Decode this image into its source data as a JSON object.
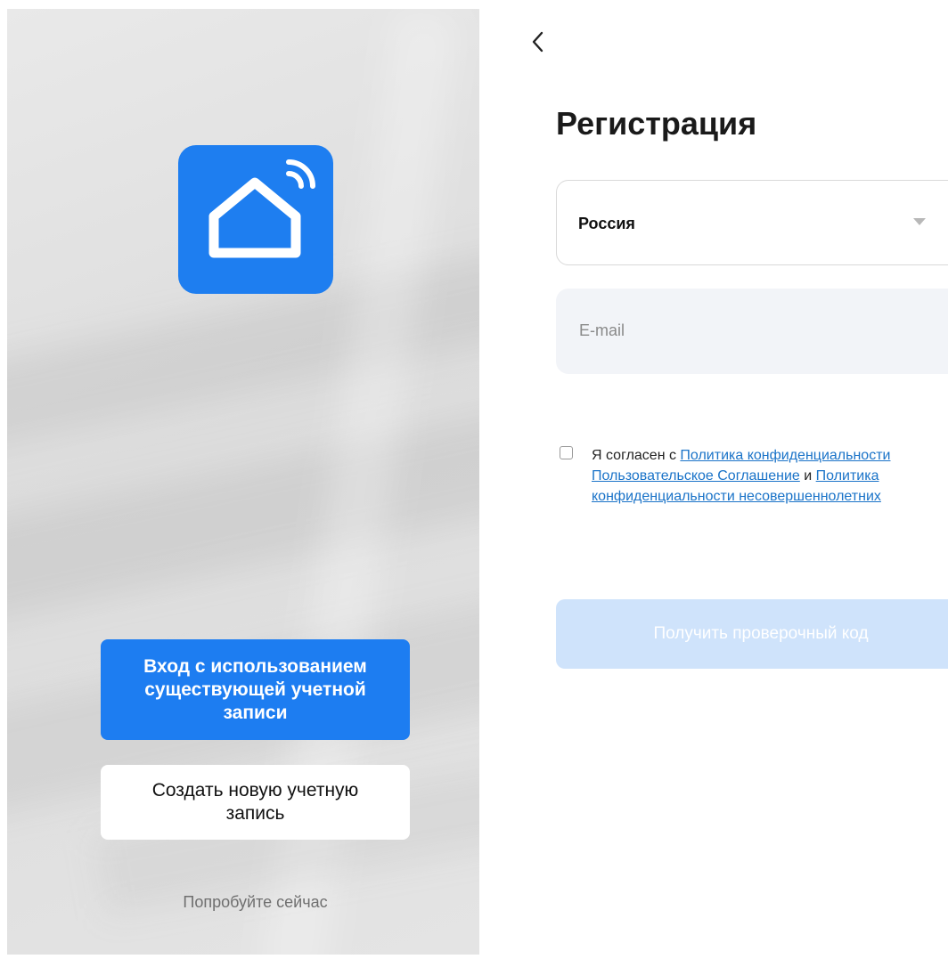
{
  "left_screen": {
    "login_button_label": "Вход с использованием существующей учетной записи",
    "create_account_label": "Создать новую учетную запись",
    "try_now_label": "Попробуйте сейчас",
    "brand_color": "#1e7ef0",
    "app_icon": "smart-home-wifi-icon"
  },
  "right_screen": {
    "back_icon": "chevron-left-icon",
    "title": "Регистрация",
    "country": {
      "value": "Россия",
      "caret_icon": "caret-down-icon"
    },
    "email": {
      "placeholder": "E-mail",
      "value": ""
    },
    "agreement": {
      "prefix": "Я согласен с ",
      "link_privacy": "Политика конфиденциальности",
      "space": " ",
      "link_terms": "Пользовательское Соглашение",
      "conjunction": " и ",
      "link_minors": "Политика конфиденциальности несовершеннолетних",
      "checked": false
    },
    "get_code_label": "Получить проверочный код",
    "link_color": "#1a73c8",
    "disabled_button_color": "#cfe3fb"
  }
}
